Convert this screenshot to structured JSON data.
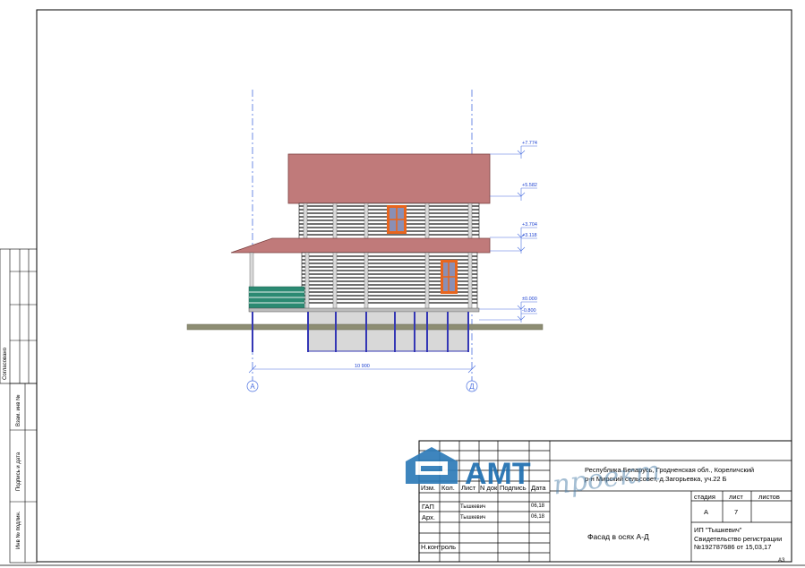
{
  "side_stamp": {
    "soglasovano": "Согласовано",
    "vzam_inv": "Взам. инв №",
    "podpis_data": "Подпись и дата",
    "inv_podl": "Инв № подлин."
  },
  "title_block": {
    "address_line1": "Республика Беларусь, Гродненская обл., Кореличский",
    "address_line2": "р-н Мирский сельсовет, д.Загорьевка, уч.22 Б",
    "headers": [
      "Изм.",
      "Кол.",
      "Лист",
      "N док",
      "Подпись",
      "Дата"
    ],
    "stage_header": "стадия",
    "sheet_header": "лист",
    "sheets_header": "листов",
    "stage_value": "А",
    "sheet_value": "7",
    "sheets_value": "",
    "drawing_title": "Фасад в осях А-Д",
    "company_line1": "ИП \"Тышкевич\"",
    "company_line2": "Свидетельство регистрации",
    "company_line3": "№192787686 от 15,03,17",
    "rows": [
      {
        "role": "ГАП",
        "name": "Тышкевич",
        "date": "06,18"
      },
      {
        "role": "Арх.",
        "name": "Тышкевич",
        "date": "06,18"
      },
      {
        "role": "",
        "name": "",
        "date": ""
      },
      {
        "role": "",
        "name": "",
        "date": ""
      },
      {
        "role": "Н.контроль",
        "name": "",
        "date": ""
      }
    ],
    "format": "А3"
  },
  "logo": {
    "brand": "АМТ",
    "script": "проект",
    "colors": {
      "icon": "#2e7bb8",
      "text": "#1f6fb0"
    }
  },
  "drawing": {
    "levels": [
      "+7.774",
      "+5.582",
      "+3.704",
      "+3.118",
      "±0.000",
      "-0.800"
    ],
    "dimension": "10 900",
    "axes": [
      "А",
      "Д"
    ],
    "colors": {
      "roof": "#c07a7a",
      "wall_line": "#1a1a1a",
      "window_frame": "#e8651d",
      "window_glass": "#8a8fb5",
      "railing": "#2b8a72",
      "foundation_post": "#3437b5",
      "ground": "#8d8d73",
      "axis_line": "#4a6fe0"
    }
  }
}
